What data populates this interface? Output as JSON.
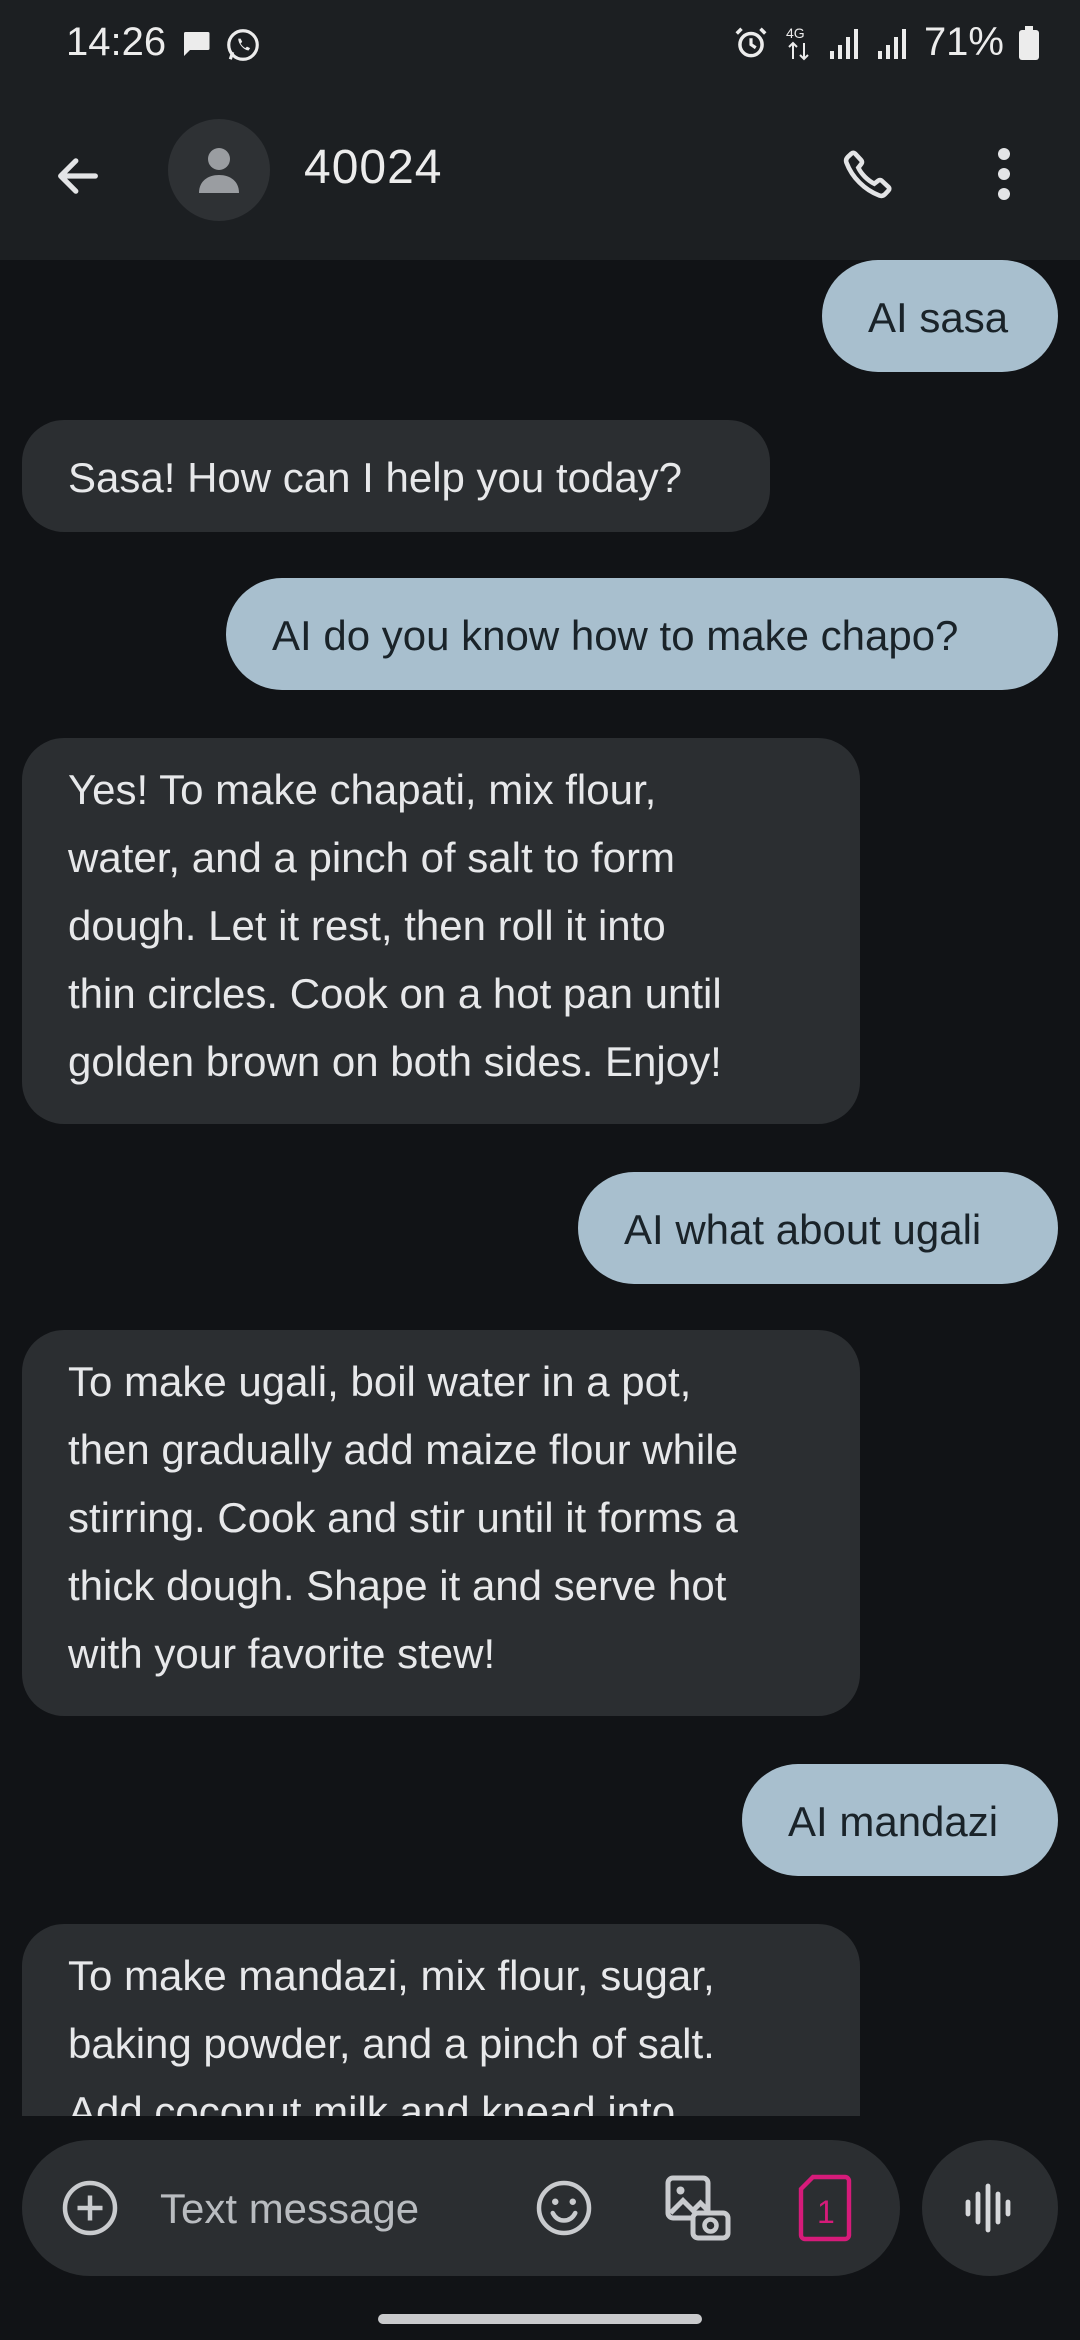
{
  "status_bar": {
    "time": "14:26",
    "battery": "71%",
    "network": "4G",
    "icons": [
      "chat-bubble-icon",
      "whatsapp-icon",
      "alarm-icon",
      "4g-data-icon",
      "signal-icon",
      "signal-icon",
      "battery-icon"
    ]
  },
  "header": {
    "contact": "40024",
    "icons": [
      "back-arrow-icon",
      "person-icon",
      "phone-icon",
      "more-vert-icon"
    ]
  },
  "messages": [
    {
      "direction": "outgoing",
      "text": "AI sasa"
    },
    {
      "direction": "incoming",
      "text": "Sasa! How can I help you today?"
    },
    {
      "direction": "outgoing",
      "text": "AI do you know how to make chapo?"
    },
    {
      "direction": "incoming",
      "lines": [
        "Yes! To make chapati, mix flour,",
        "water, and a pinch of salt to form",
        "dough. Let it rest, then roll it into",
        "thin circles. Cook on a hot pan until",
        "golden brown on both sides. Enjoy!"
      ]
    },
    {
      "direction": "outgoing",
      "text": "AI what about ugali"
    },
    {
      "direction": "incoming",
      "lines": [
        "To make ugali, boil water in a pot,",
        "then gradually add maize flour while",
        "stirring. Cook and stir until it forms a",
        "thick dough. Shape it and serve hot",
        "with your favorite stew!"
      ]
    },
    {
      "direction": "outgoing",
      "text": "AI mandazi"
    },
    {
      "direction": "incoming",
      "lines": [
        "To make mandazi, mix flour, sugar,",
        "baking powder, and a pinch of salt.",
        "Add coconut milk and knead into"
      ]
    }
  ],
  "composer": {
    "placeholder": "Text message",
    "sim_label": "1",
    "icons": [
      "add-circle-icon",
      "emoji-icon",
      "gallery-icon",
      "sim-card-icon",
      "voice-wave-icon"
    ]
  },
  "colors": {
    "background": "#111316",
    "bar": "#1c1f22",
    "outgoing_bubble": "#a8bfce",
    "incoming_bubble": "#2b2e31",
    "sim_accent": "#d61b7a"
  }
}
